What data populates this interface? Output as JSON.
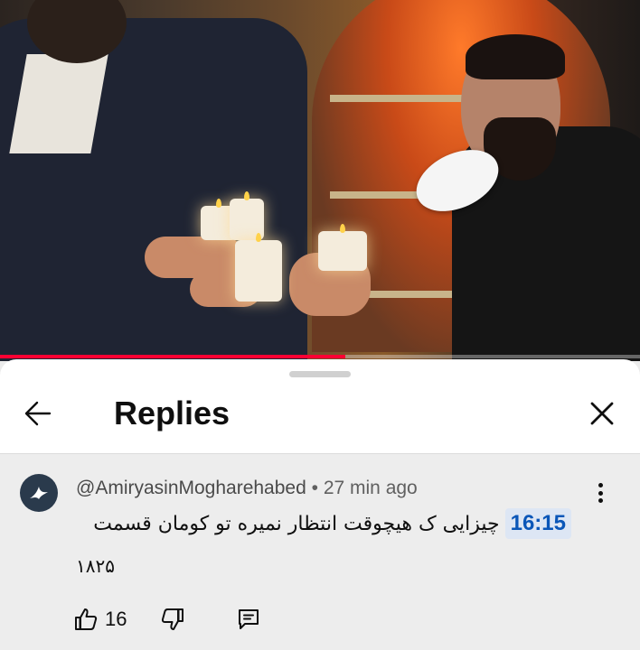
{
  "video": {
    "progress": 0.54,
    "accent_color": "#ff0033"
  },
  "sheet": {
    "title": "Replies",
    "back_icon": "arrow-left-icon",
    "close_icon": "close-icon"
  },
  "comment": {
    "author": "@AmiryasinMogharehabed",
    "separator": "•",
    "time_ago": "27 min ago",
    "timestamp": "16:15",
    "text_line1": "چیزایی ک هیچوقت انتظار نمیره تو کومان قسمت",
    "text_line2": "۱۸۲۵",
    "likes": "16",
    "timestamp_color": "#0a56b8"
  }
}
